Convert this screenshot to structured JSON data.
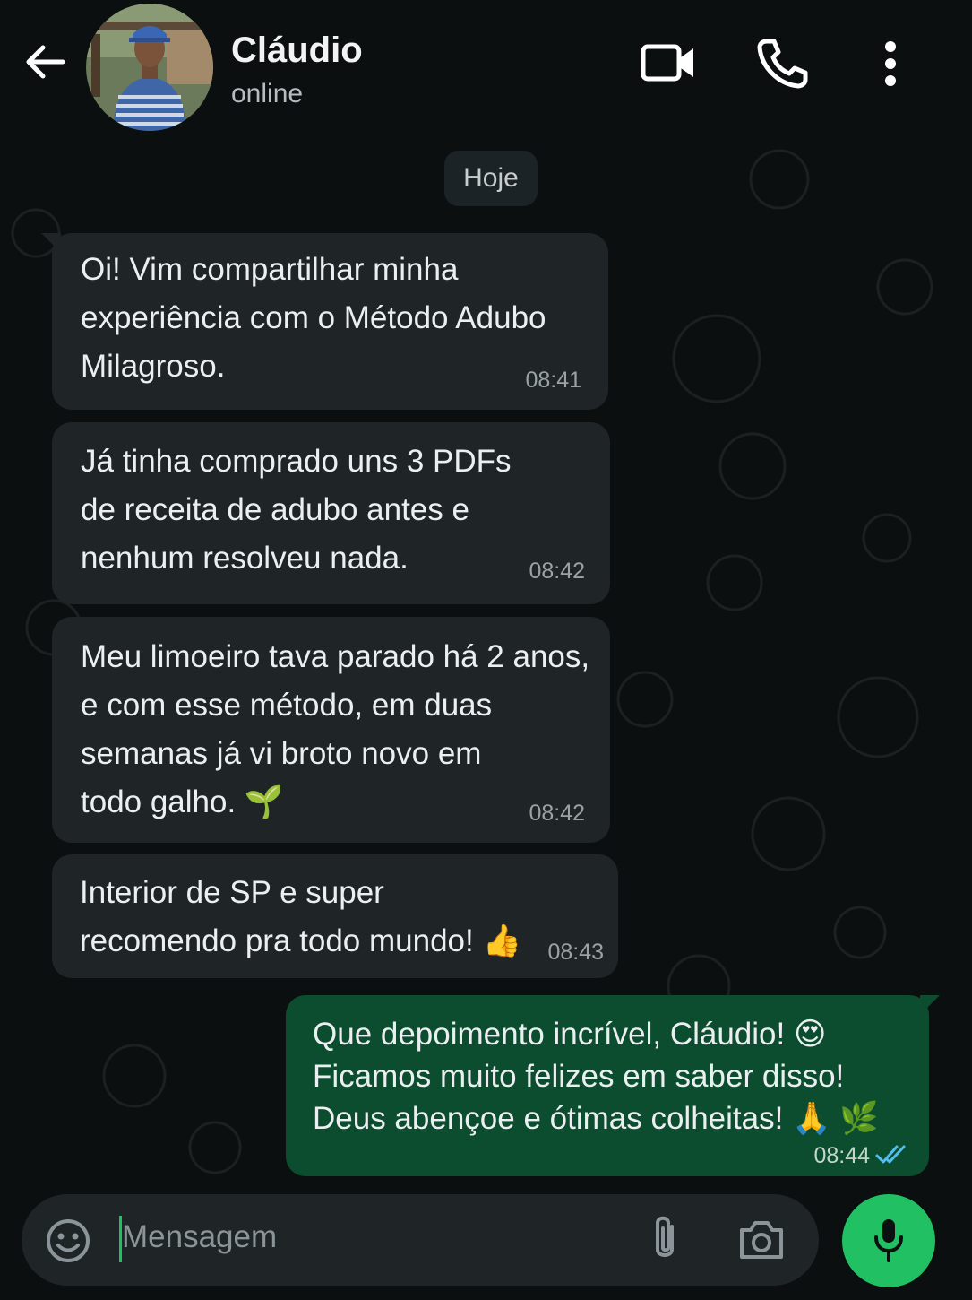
{
  "contact": {
    "name": "Cláudio",
    "status": "online"
  },
  "header_icons": [
    "arrow-left-icon",
    "video-call-icon",
    "phone-icon",
    "more-vertical-icon"
  ],
  "date_separator": "Hoje",
  "messages": [
    {
      "direction": "in",
      "text": "Oi! Vim compartilhar minha\nexperiência com o Método Adubo\nMilagroso.",
      "time": "08:41"
    },
    {
      "direction": "in",
      "text": "Já tinha comprado uns 3 PDFs\nde receita de adubo antes e\nnenhum resolveu nada.",
      "time": "08:42"
    },
    {
      "direction": "in",
      "text": "Meu limoeiro tava parado há 2 anos,\ne com esse método, em duas\nsemanas já vi broto novo em\ntodo galho. 🌱",
      "time": "08:42"
    },
    {
      "direction": "in",
      "text": "Interior de SP e super\nrecomendo pra todo mundo! 👍",
      "time": "08:43"
    },
    {
      "direction": "out",
      "text": "Que depoimento incrível, Cláudio! 😍\nFicamos muito felizes em saber disso!\nDeus abençoe e ótimas colheitas! 🙏 🌿",
      "time": "08:44",
      "status": "read"
    }
  ],
  "composer": {
    "placeholder": "Mensagem"
  },
  "colors": {
    "background": "#0b0f10",
    "incoming_bubble": "#1f2426",
    "outgoing_bubble": "#0d4d2f",
    "accent": "#21c063",
    "read_ticks": "#53bdeb"
  }
}
